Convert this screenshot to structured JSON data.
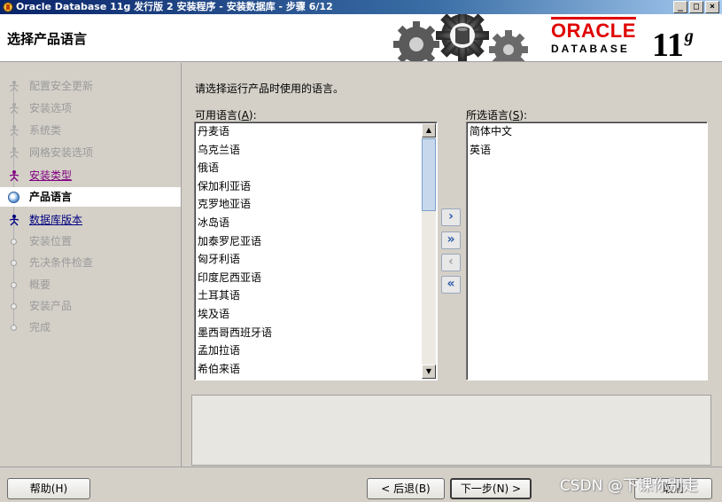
{
  "window": {
    "title": "Oracle Database 11g 发行版 2 安装程序 - 安装数据库 - 步骤 6/12",
    "controls": [
      "_",
      "□",
      "×"
    ]
  },
  "header": {
    "page_title": "选择产品语言",
    "logo_brand": "ORACLE",
    "logo_product": "DATABASE",
    "logo_version": "11",
    "logo_version_suffix": "g"
  },
  "steps": [
    {
      "label": "配置安全更新",
      "state": "done"
    },
    {
      "label": "安装选项",
      "state": "done"
    },
    {
      "label": "系统类",
      "state": "done"
    },
    {
      "label": "网格安装选项",
      "state": "done"
    },
    {
      "label": "安装类型",
      "state": "visited"
    },
    {
      "label": "产品语言",
      "state": "current"
    },
    {
      "label": "数据库版本",
      "state": "link"
    },
    {
      "label": "安装位置",
      "state": "pending"
    },
    {
      "label": "先决条件检查",
      "state": "pending"
    },
    {
      "label": "概要",
      "state": "pending"
    },
    {
      "label": "安装产品",
      "state": "pending"
    },
    {
      "label": "完成",
      "state": "pending"
    }
  ],
  "main": {
    "prompt": "请选择运行产品时使用的语言。",
    "available_label": "可用语言(",
    "available_key": "A",
    "available_suffix": "):",
    "selected_label": "所选语言(",
    "selected_key": "S",
    "selected_suffix": "):",
    "available_languages": [
      "丹麦语",
      "乌克兰语",
      "俄语",
      "保加利亚语",
      "克罗地亚语",
      "冰岛语",
      "加泰罗尼亚语",
      "匈牙利语",
      "印度尼西亚语",
      "土耳其语",
      "埃及语",
      "墨西哥西班牙语",
      "孟加拉语",
      "希伯来语"
    ],
    "selected_languages": [
      "简体中文",
      "英语"
    ],
    "move_buttons": {
      "add": "›",
      "add_all": "»",
      "remove": "‹",
      "remove_all": "«"
    }
  },
  "footer": {
    "help": "帮助(H)",
    "back": "< 后退(B)",
    "next": "下一步(N) >",
    "cancel": "取消",
    "watermark": "CSDN @下课你别走"
  },
  "colors": {
    "oracle_red": "#e00000",
    "link_blue": "#000080",
    "visited_purple": "#800080",
    "arrow_blue": "#2a5aa8"
  }
}
